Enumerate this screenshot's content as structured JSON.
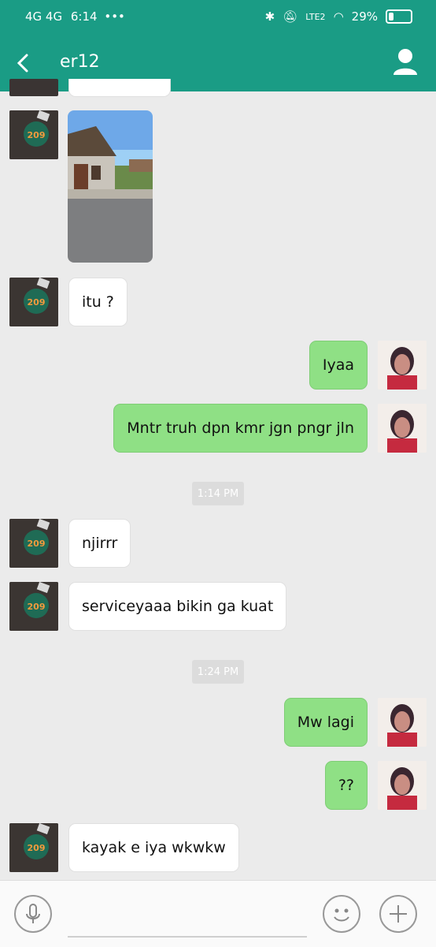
{
  "status_bar": {
    "network": "4G 4G",
    "time": "6:14",
    "lte": "LTE2",
    "battery_percent": "29%",
    "battery_level": 0.29
  },
  "header": {
    "title": "er12"
  },
  "messages": [
    {
      "side": "left",
      "type": "image"
    },
    {
      "side": "left",
      "type": "text",
      "text": "itu ?"
    },
    {
      "side": "right",
      "type": "text",
      "text": "Iyaa"
    },
    {
      "side": "right",
      "type": "text",
      "text": "Mntr truh dpn kmr jgn pngr jln"
    },
    {
      "type": "time",
      "text": "1:14 PM"
    },
    {
      "side": "left",
      "type": "text",
      "text": "njirrr"
    },
    {
      "side": "left",
      "type": "text",
      "text": "serviceyaaa bikin ga kuat"
    },
    {
      "type": "time",
      "text": "1:24 PM"
    },
    {
      "side": "right",
      "type": "text",
      "text": "Mw lagi"
    },
    {
      "side": "right",
      "type": "text",
      "text": "??"
    },
    {
      "side": "left",
      "type": "text",
      "text": "kayak e iya wkwkw"
    }
  ],
  "avatar_left": {
    "badge_text": "209",
    "badge_color": "#1f6b55"
  },
  "colors": {
    "accent": "#1a9c85",
    "sent_bubble": "#8fe085",
    "received_bubble": "#ffffff"
  },
  "input_bar": {
    "icons": [
      "microphone-icon",
      "emoji-icon",
      "plus-icon"
    ]
  }
}
